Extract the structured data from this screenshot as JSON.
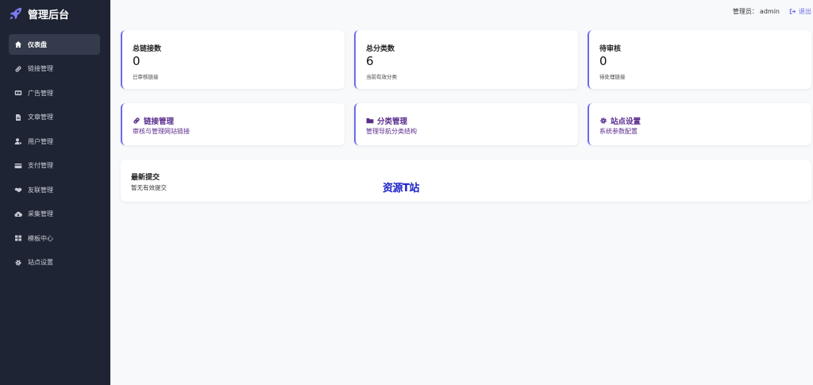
{
  "sidebar": {
    "brand": {
      "title": "管理后台",
      "icon": "rocket-icon"
    },
    "items": [
      {
        "label": "仪表盘",
        "icon": "home-icon",
        "active": true
      },
      {
        "label": "链接管理",
        "icon": "link-icon"
      },
      {
        "label": "广告管理",
        "icon": "ad-icon"
      },
      {
        "label": "文章管理",
        "icon": "file-icon"
      },
      {
        "label": "用户管理",
        "icon": "user-cog-icon"
      },
      {
        "label": "支付管理",
        "icon": "credit-card-icon"
      },
      {
        "label": "友联管理",
        "icon": "handshake-icon"
      },
      {
        "label": "采集管理",
        "icon": "cloud-download-icon"
      },
      {
        "label": "模板中心",
        "icon": "grid-icon"
      },
      {
        "label": "站点设置",
        "icon": "gear-icon"
      }
    ]
  },
  "header": {
    "admin_label": "管理员：",
    "admin_name": "admin",
    "logout_label": "退出"
  },
  "stats": [
    {
      "title": "总链接数",
      "value": "0",
      "sub": "已审核链接"
    },
    {
      "title": "总分类数",
      "value": "6",
      "sub": "当前有效分类"
    },
    {
      "title": "待审核",
      "value": "0",
      "sub": "待处理链接"
    }
  ],
  "quick": [
    {
      "title": "链接管理",
      "desc": "审核与管理网站链接",
      "icon": "link-icon"
    },
    {
      "title": "分类管理",
      "desc": "管理导航分类结构",
      "icon": "folder-icon"
    },
    {
      "title": "站点设置",
      "desc": "系统参数配置",
      "icon": "gear-icon"
    }
  ],
  "recent": {
    "title": "最新提交",
    "empty": "暂无有效提交"
  },
  "watermark": "资源T站",
  "colors": {
    "sidebar_bg": "#1e2433",
    "accent": "#6d6ce8",
    "quick_text": "#5b2d8e"
  }
}
